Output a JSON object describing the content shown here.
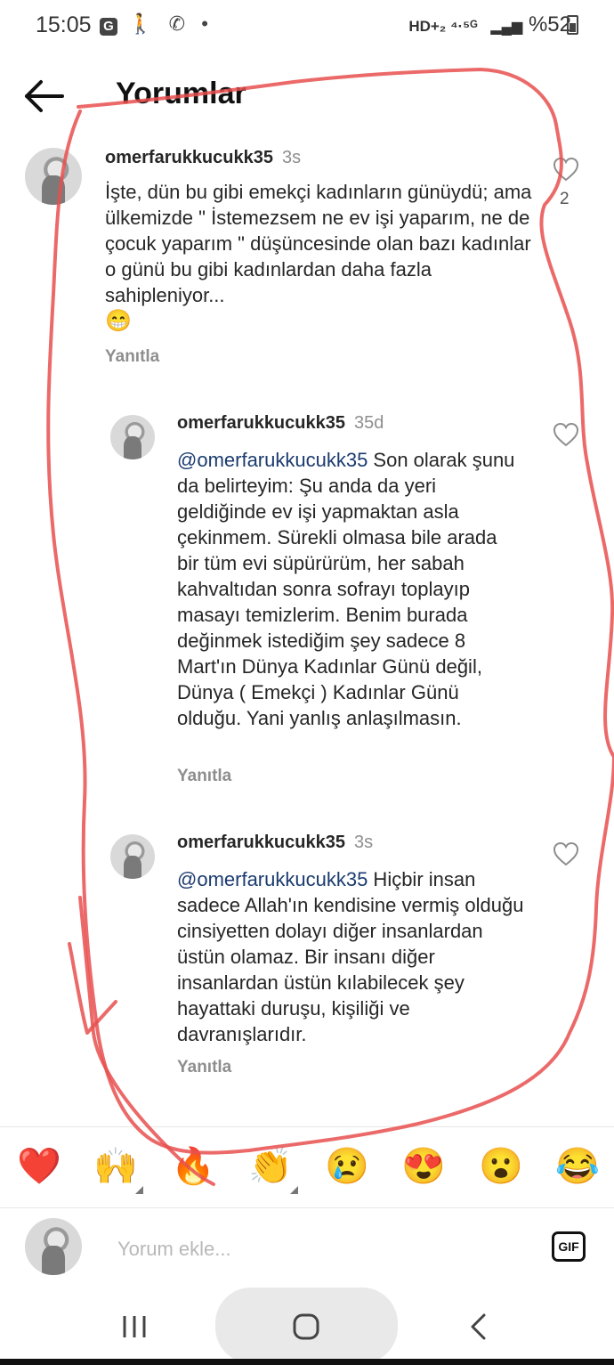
{
  "status_bar": {
    "time": "15:05",
    "icons": [
      "g-icon",
      "walking-icon",
      "whatsapp-icon",
      "dot"
    ],
    "network": "HD+₂ ⁴·⁵ᴳ",
    "battery": "%52"
  },
  "header": {
    "title": "Yorumlar"
  },
  "comments": [
    {
      "username": "omerfarukkucukk35",
      "time": "3s",
      "text": "İşte, dün bu gibi emekçi kadınların günüydü; ama ülkemizde \" İstemezsem ne ev işi yaparım, ne de çocuk  yaparım \" düşüncesinde olan bazı kadınlar o günü bu gibi kadınlardan daha fazla sahipleniyor...",
      "emoji": "😁",
      "reply_label": "Yanıtla",
      "likes": "2"
    },
    {
      "username": "omerfarukkucukk35",
      "time": "35d",
      "mention": "@omerfarukkucukk35",
      "text": " Son olarak şunu da belirteyim: Şu anda da yeri geldiğinde ev işi yapmaktan asla çekinmem. Sürekli olmasa bile arada bir tüm evi süpürürüm, her sabah kahvaltıdan sonra sofrayı toplayıp masayı temizlerim. Benim burada değinmek istediğim şey sadece 8 Mart'ın Dünya Kadınlar Günü değil, Dünya ( Emekçi ) Kadınlar Günü olduğu. Yani yanlış anlaşılmasın.",
      "reply_label": "Yanıtla"
    },
    {
      "username": "omerfarukkucukk35",
      "time": "3s",
      "mention": "@omerfarukkucukk35",
      "text": " Hiçbir insan sadece Allah'ın kendisine vermiş olduğu cinsiyetten dolayı  diğer insanlardan üstün olamaz. Bir insanı diğer insanlardan üstün kılabilecek şey  hayattaki duruşu, kişiliği ve davranışlarıdır.",
      "reply_label": "Yanıtla"
    }
  ],
  "emoji_bar": [
    "❤️",
    "🙌",
    "🔥",
    "👏",
    "😢",
    "😍",
    "😮",
    "😂"
  ],
  "composer": {
    "placeholder": "Yorum ekle...",
    "gif_label": "GIF"
  },
  "colors": {
    "annotation": "#e8504f",
    "mention": "#1b3b6f",
    "muted": "#8e8e8e"
  }
}
